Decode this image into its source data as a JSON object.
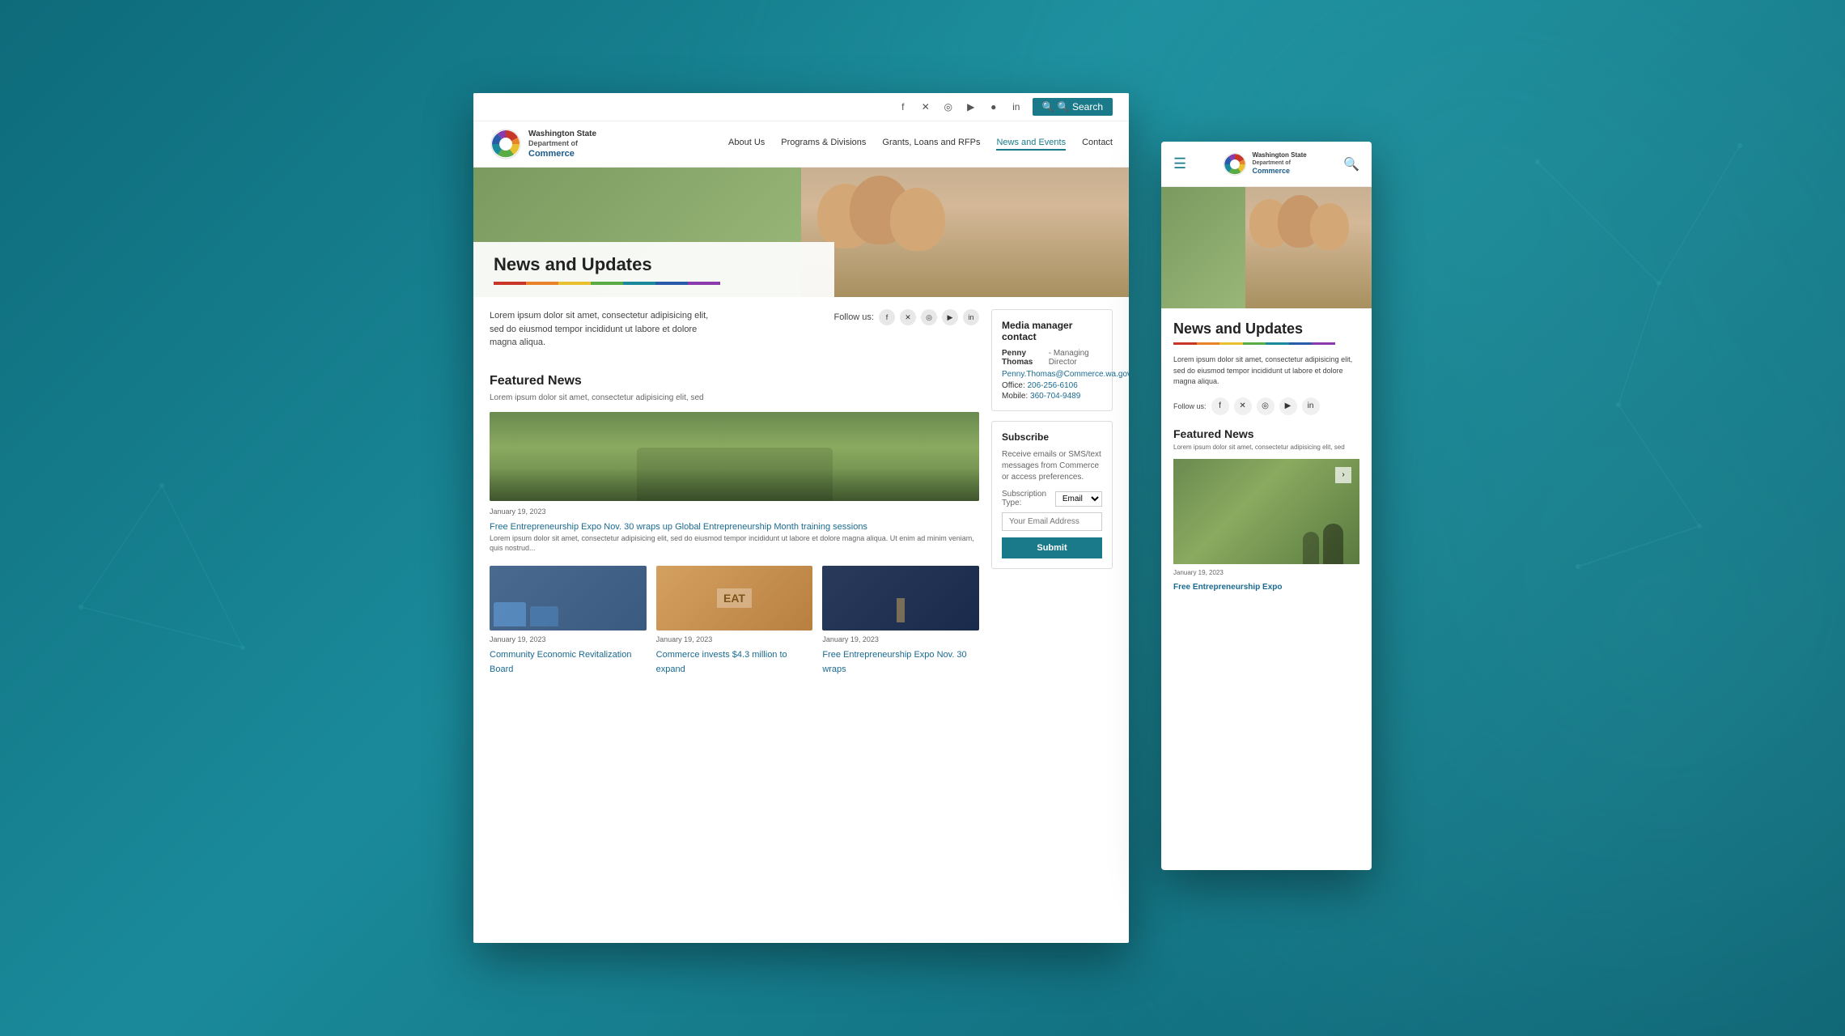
{
  "background": {
    "color": "#0e6b7a"
  },
  "desktop": {
    "topBar": {
      "searchLabel": "🔍 Search",
      "socialIcons": [
        "f",
        "𝕏",
        "📷",
        "▶",
        "in"
      ]
    },
    "nav": {
      "logoText": "Washington State\nDepartment of\nCommerce",
      "links": [
        {
          "label": "About Us",
          "active": false
        },
        {
          "label": "Programs & Divisions",
          "active": false
        },
        {
          "label": "Grants, Loans and RFPs",
          "active": false
        },
        {
          "label": "News and Events",
          "active": true
        },
        {
          "label": "Contact",
          "active": false
        }
      ]
    },
    "hero": {
      "title": "News and Updates"
    },
    "colorBar": {
      "colors": [
        "#c8362a",
        "#e8832a",
        "#e8c030",
        "#5aaa46",
        "#1a8a9a",
        "#2a5aaa",
        "#8a3aaa"
      ]
    },
    "main": {
      "introText": "Lorem ipsum dolor sit amet, consectetur adipisicing elit, sed do eiusmod tempor incididunt ut labore et dolore magna aliqua.",
      "followLabel": "Follow us:",
      "featuredNews": {
        "sectionTitle": "Featured News",
        "subtitle": "Lorem ipsum dolor sit amet, consectetur adipisicing elit, sed",
        "newsDate": "January 19, 2023",
        "newsTitle": "Free Entrepreneurship Expo Nov. 30 wraps up Global Entrepreneurship Month training sessions",
        "newsExcerpt": "Lorem ipsum dolor sit amet, consectetur adipisicing elit, sed do eiusmod tempor incididunt ut labore et dolore magna aliqua. Ut enim ad minim veniam, quis nostrud..."
      },
      "gridNews": [
        {
          "date": "January 19, 2023",
          "title": "Community Economic Revitalization Board",
          "imageClass": "camping"
        },
        {
          "date": "January 19, 2023",
          "title": "Commerce invests $4.3 million to expand",
          "imageClass": "food"
        },
        {
          "date": "January 19, 2023",
          "title": "Free Entrepreneurship Expo Nov. 30 wraps",
          "imageClass": "night"
        }
      ]
    },
    "sidebar": {
      "mediaContact": {
        "title": "Media manager contact",
        "name": "Penny Thomas",
        "role": "Managing Director",
        "email": "Penny.Thomas@Commerce.wa.gov",
        "officeLabel": "Office:",
        "officePhone": "206-256-6106",
        "mobileLabel": "Mobile:",
        "mobilePhone": "360-704-9489"
      },
      "subscribe": {
        "title": "Subscribe",
        "text": "Receive emails or SMS/text messages from Commerce or access preferences.",
        "subscriptionTypeLabel": "Subscription Type:",
        "subscriptionTypeValue": "Email",
        "emailPlaceholder": "Your Email Address",
        "submitLabel": "Submit"
      }
    }
  },
  "mobile": {
    "header": {
      "menuIcon": "☰",
      "logoText": "Washington State\nDepartment of\nCommerce",
      "searchIcon": "🔍"
    },
    "hero": {
      "title": "News and Updates"
    },
    "colorBar": {
      "colors": [
        "#c8362a",
        "#e8832a",
        "#e8c030",
        "#5aaa46",
        "#1a8a9a",
        "#2a5aaa",
        "#8a3aaa"
      ]
    },
    "content": {
      "introText": "Lorem ipsum dolor sit amet, consectetur adipisicing elit, sed do eiusmod tempor incididunt ut labore et dolore magna aliqua.",
      "followLabel": "Follow us:",
      "featuredNews": {
        "sectionTitle": "Featured News",
        "subtitle": "Lorem ipsum dolor sit amet, consectetur adipisicing elit, sed",
        "newsDate": "January 19, 2023",
        "newsTitle": "Free Entrepreneurship Expo"
      }
    }
  }
}
